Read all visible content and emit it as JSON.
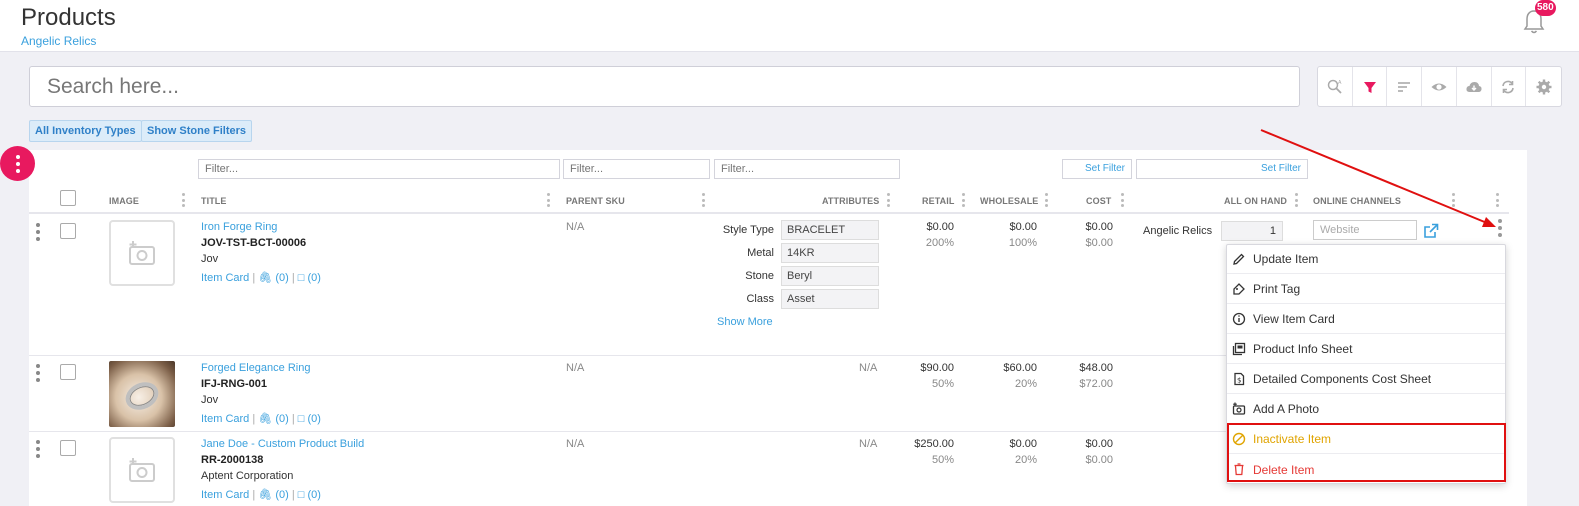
{
  "header": {
    "title": "Products",
    "subtitle": "Angelic Relics",
    "notification_count": "580"
  },
  "search": {
    "placeholder": "Search here..."
  },
  "toolbar": {
    "icons": [
      "advanced-search-icon",
      "filter-icon",
      "sort-icon",
      "view-icon",
      "cloud-download-icon",
      "sync-icon",
      "settings-icon"
    ],
    "active_color": "#e8195f"
  },
  "chips": {
    "inventory_types": "All Inventory Types",
    "stone_filters": "Show Stone Filters"
  },
  "filters": {
    "title_placeholder": "Filter...",
    "parent_sku_placeholder": "Filter...",
    "attributes_placeholder": "Filter...",
    "set_filter_cost": "Set Filter",
    "set_filter_on_hand": "Set Filter"
  },
  "columns": {
    "image": "IMAGE",
    "title": "TITLE",
    "parent_sku": "PARENT SKU",
    "attributes": "ATTRIBUTES",
    "retail": "RETAIL",
    "wholesale": "WHOLESALE",
    "cost": "COST",
    "all_on_hand": "ALL ON HAND",
    "online_channels": "ONLINE CHANNELS"
  },
  "rows": [
    {
      "title": "Iron Forge Ring",
      "sku": "JOV-TST-BCT-00006",
      "vendor": "Jov",
      "item_card": "Item Card",
      "attachments": "(0)",
      "comments": "(0)",
      "parent_sku": "N/A",
      "attributes": [
        {
          "label": "Style Type",
          "value": "BRACELET"
        },
        {
          "label": "Metal",
          "value": "14KR"
        },
        {
          "label": "Stone",
          "value": "Beryl"
        },
        {
          "label": "Class",
          "value": "Asset"
        }
      ],
      "show_more": "Show More",
      "retail": "$0.00",
      "retail_pct": "200%",
      "wholesale": "$0.00",
      "wholesale_pct": "100%",
      "cost": "$0.00",
      "cost_sub": "$0.00",
      "location": "Angelic Relics",
      "on_hand": "1",
      "channel": "Website"
    },
    {
      "title": "Forged Elegance Ring",
      "sku": "IFJ-RNG-001",
      "vendor": "Jov",
      "item_card": "Item Card",
      "attachments": "(0)",
      "comments": "(0)",
      "parent_sku": "N/A",
      "attributes_text": "N/A",
      "retail": "$90.00",
      "retail_pct": "50%",
      "wholesale": "$60.00",
      "wholesale_pct": "20%",
      "cost": "$48.00",
      "cost_sub": "$72.00"
    },
    {
      "title": "Jane Doe - Custom Product Build",
      "sku": "RR-2000138",
      "vendor": "Aptent Corporation",
      "item_card": "Item Card",
      "attachments": "(0)",
      "comments": "(0)",
      "parent_sku": "N/A",
      "attributes_text": "N/A",
      "retail": "$250.00",
      "retail_pct": "50%",
      "wholesale": "$0.00",
      "wholesale_pct": "20%",
      "cost": "$0.00",
      "cost_sub": "$0.00"
    }
  ],
  "context_menu": {
    "items": [
      {
        "label": "Update Item",
        "icon": "pencil-icon"
      },
      {
        "label": "Print Tag",
        "icon": "tag-icon"
      },
      {
        "label": "View Item Card",
        "icon": "info-icon"
      },
      {
        "label": "Product Info Sheet",
        "icon": "sheet-icon"
      },
      {
        "label": "Detailed Components Cost Sheet",
        "icon": "cost-sheet-icon"
      },
      {
        "label": "Add A Photo",
        "icon": "add-photo-icon"
      },
      {
        "label": "Inactivate Item",
        "icon": "ban-icon"
      },
      {
        "label": "Delete Item",
        "icon": "trash-icon"
      }
    ],
    "warn_color": "#e0a400",
    "danger_color": "#e53935"
  },
  "colors": {
    "accent": "#e8195f",
    "link": "#3aa0dd",
    "annotation": "#e01010"
  }
}
